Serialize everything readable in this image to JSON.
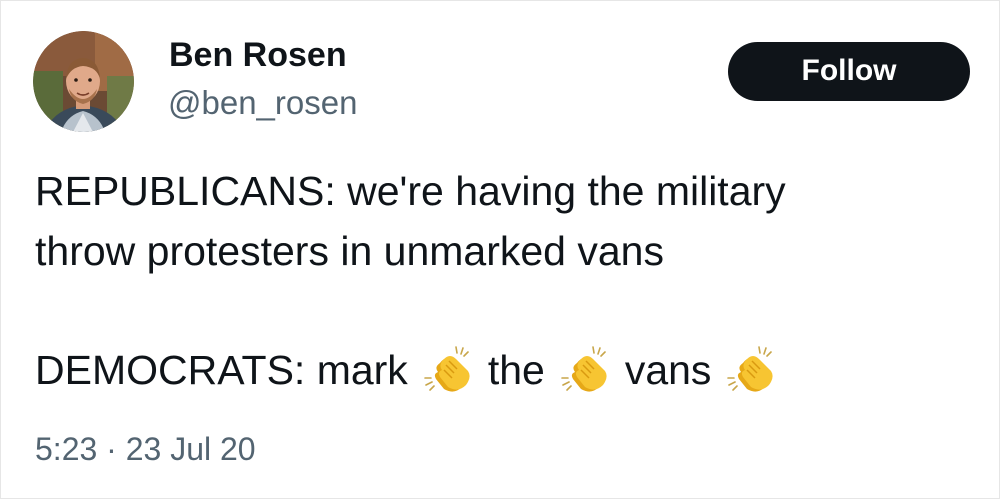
{
  "author": {
    "display_name": "Ben Rosen",
    "handle": "@ben_rosen",
    "avatar_icon": "profile-photo"
  },
  "follow_button": {
    "label": "Follow",
    "background": "#0f1419",
    "text_color": "#ffffff"
  },
  "tweet": {
    "line1": "REPUBLICANS: we're having the military",
    "line2": "throw protesters in unmarked vans",
    "line3_parts": [
      "DEMOCRATS: mark",
      "the",
      "vans"
    ],
    "emoji": "clapping-hands-icon",
    "emoji_color": "#f5c518"
  },
  "timestamp": "5:23 · 23 Jul 20",
  "colors": {
    "text": "#0f1419",
    "secondary_text": "#536471",
    "background": "#ffffff"
  }
}
